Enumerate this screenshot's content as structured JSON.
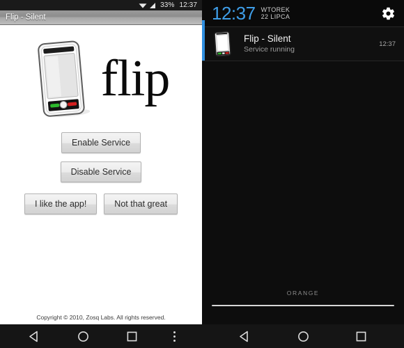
{
  "app": {
    "statusbar": {
      "wifi_icon": "wifi-icon",
      "signal_icon": "signal-icon",
      "battery": "33%",
      "clock": "12:37"
    },
    "titlebar": {
      "title": "Flip - Silent"
    },
    "logo": {
      "phone_icon": "phone-icon",
      "wordmark": "flip"
    },
    "buttons": {
      "enable": "Enable Service",
      "disable": "Disable Service",
      "like": "I like the app!",
      "dislike": "Not that great"
    },
    "footer": {
      "copyright": "Copyright © 2010, Zosq Labs. All rights reserved."
    },
    "navbar": {
      "back": "back-icon",
      "home": "home-icon",
      "recents": "recents-icon",
      "overflow": "overflow-menu-icon"
    }
  },
  "shade": {
    "header": {
      "time": "12:37",
      "day": "WTOREK",
      "date": "22 LIPCA",
      "settings_icon": "gear-icon"
    },
    "notification": {
      "icon": "phone-icon",
      "title": "Flip - Silent",
      "subtitle": "Service running",
      "time": "12:37"
    },
    "carrier": "ORANGE",
    "handle": "drag-handle",
    "navbar": {
      "back": "back-icon",
      "home": "home-icon",
      "recents": "recents-icon"
    }
  },
  "colors": {
    "accent_blue": "#2f8fe0",
    "clock_blue": "#3f9ee8",
    "titlebar_gray": "#9a9a9a",
    "call_green": "#2db92d",
    "end_red": "#d42020"
  }
}
